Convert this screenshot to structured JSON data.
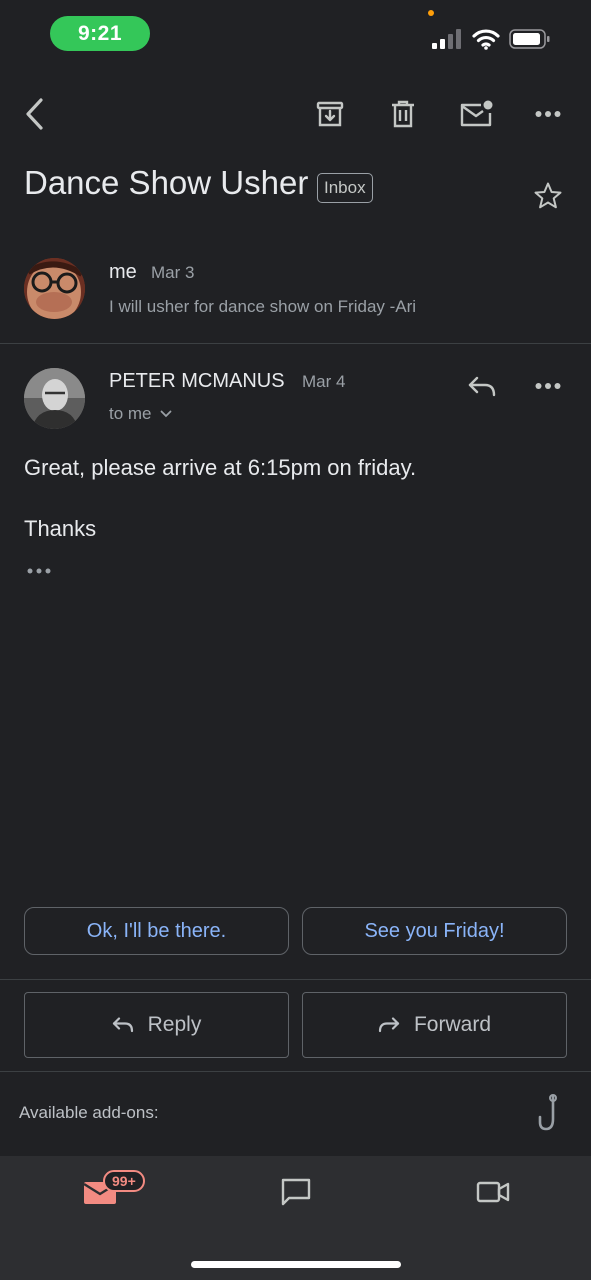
{
  "status_bar": {
    "time": "9:21"
  },
  "thread": {
    "subject": "Dance Show Usher",
    "label": "Inbox"
  },
  "messages": [
    {
      "sender": "me",
      "date": "Mar 3",
      "snippet": "I will usher for dance show on Friday -Ari"
    },
    {
      "sender": "PETER MCMANUS",
      "date": "Mar 4",
      "recipient": "to me",
      "body_line1": "Great, please arrive at 6:15pm on friday.",
      "body_line2": "Thanks"
    }
  ],
  "smart_replies": [
    "Ok, I'll be there.",
    "See you Friday!"
  ],
  "actions": {
    "reply": "Reply",
    "forward": "Forward"
  },
  "addons_label": "Available add-ons:",
  "bottom_nav": {
    "mail_badge": "99+"
  },
  "colors": {
    "background": "#202124",
    "accent_blue": "#8ab4f8",
    "mail_red": "#f28b82",
    "status_green": "#34c759"
  }
}
